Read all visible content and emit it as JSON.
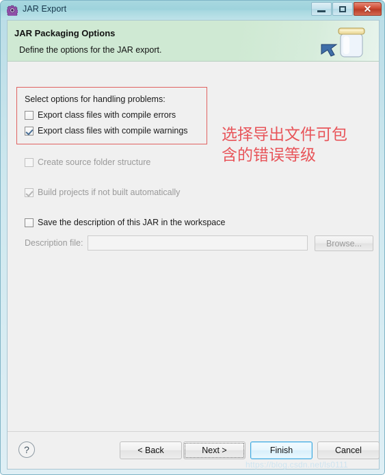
{
  "window": {
    "title": "JAR Export",
    "title_icon": "jar-export-gear-icon",
    "controls": {
      "minimize": "minimize-icon",
      "maximize": "maximize-icon",
      "close": "✕"
    }
  },
  "banner": {
    "title": "JAR Packaging Options",
    "description": "Define the options for the JAR export.",
    "art_icon": "jar-jar-icon"
  },
  "options": {
    "group_label": "Select options for handling problems:",
    "items": [
      {
        "label": "Export class files with compile errors",
        "checked": false,
        "enabled": true
      },
      {
        "label": "Export class files with compile warnings",
        "checked": true,
        "enabled": true
      },
      {
        "label": "Create source folder structure",
        "checked": false,
        "enabled": false
      },
      {
        "label": "Build projects if not built automatically",
        "checked": true,
        "enabled": false
      },
      {
        "label": "Save the description of this JAR in the workspace",
        "checked": false,
        "enabled": true
      }
    ]
  },
  "description_file": {
    "label": "Description file:",
    "value": "",
    "placeholder": "",
    "browse_label": "Browse..."
  },
  "annotation": {
    "text": "选择导出文件可包\n含的错误等级",
    "color": "#e8555a"
  },
  "buttons": {
    "help": "?",
    "back": "< Back",
    "next": "Next >",
    "finish": "Finish",
    "cancel": "Cancel"
  },
  "watermark": {
    "text": "https://blog.csdn.net/ls0111"
  },
  "colors": {
    "banner_green": "#cfe9d3",
    "titlebar_cyan": "#9ed3dc",
    "close_red": "#cf4b33",
    "focus_blue": "#3ea9e0",
    "annotation_red": "#e8555a",
    "box_red": "#e0615f"
  }
}
